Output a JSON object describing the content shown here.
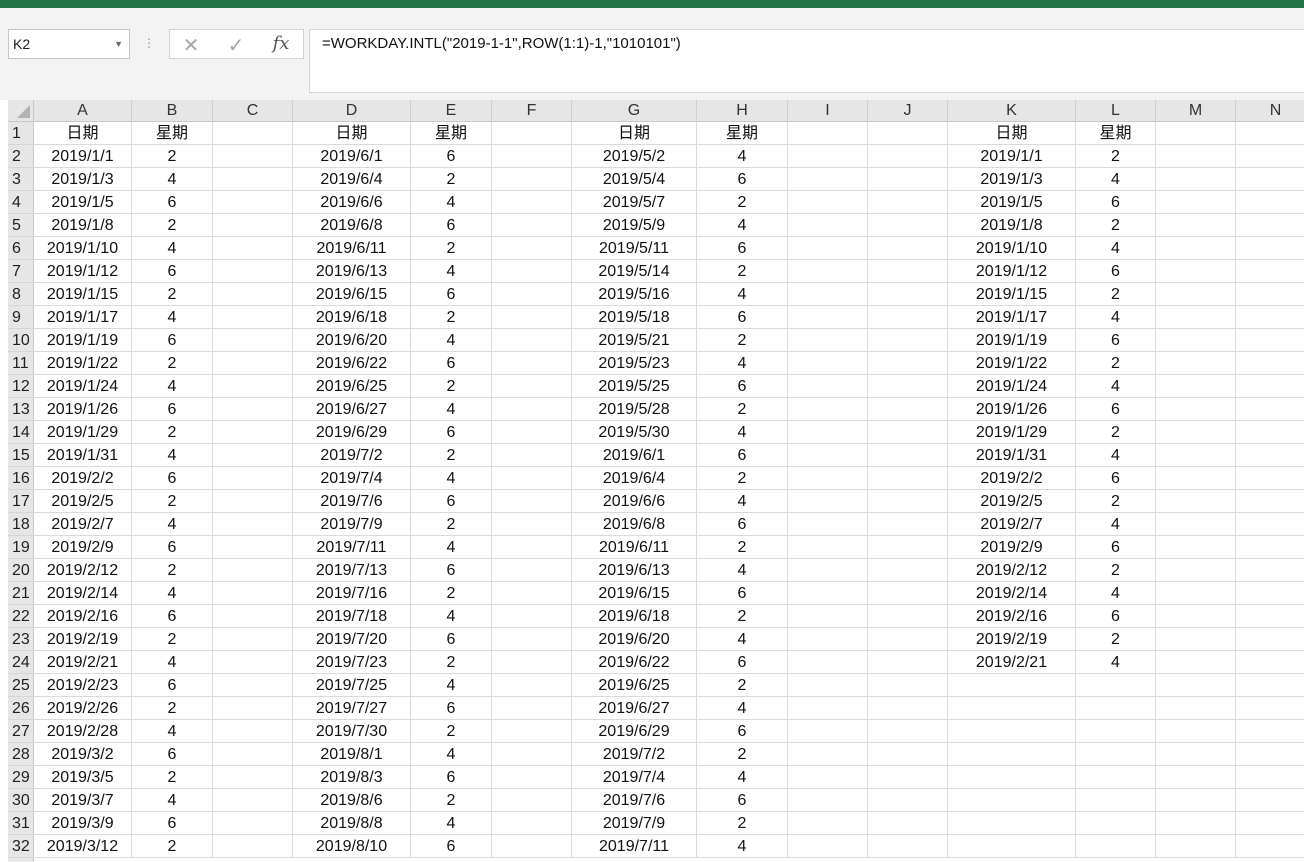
{
  "formula_bar": {
    "name_box": "K2",
    "cancel_glyph": "✕",
    "enter_glyph": "✓",
    "fx_label": "fx",
    "formula": "=WORKDAY.INTL(\"2019-1-1\",ROW(1:1)-1,\"1010101\")"
  },
  "icons": {
    "name_box_dropdown": "chevron-down-icon",
    "cancel": "close-icon",
    "enter": "check-icon",
    "insert_function": "fx-icon",
    "select_all": "select-all-triangle-icon"
  },
  "colors": {
    "ribbon": "#217346",
    "header_bg": "#e6e6e6",
    "gridline": "#dadada"
  },
  "columns": [
    "A",
    "B",
    "C",
    "D",
    "E",
    "F",
    "G",
    "H",
    "I",
    "J",
    "K",
    "L",
    "M",
    "N"
  ],
  "rows": [
    "1",
    "2",
    "3",
    "4",
    "5",
    "6",
    "7",
    "8",
    "9",
    "10",
    "11",
    "12",
    "13",
    "14",
    "15",
    "16",
    "17",
    "18",
    "19",
    "20",
    "21",
    "22",
    "23",
    "24",
    "25",
    "26",
    "27",
    "28",
    "29",
    "30",
    "31",
    "32"
  ],
  "table_ab": {
    "header": [
      "日期",
      "星期"
    ],
    "rows": [
      [
        "2019/1/1",
        "2"
      ],
      [
        "2019/1/3",
        "4"
      ],
      [
        "2019/1/5",
        "6"
      ],
      [
        "2019/1/8",
        "2"
      ],
      [
        "2019/1/10",
        "4"
      ],
      [
        "2019/1/12",
        "6"
      ],
      [
        "2019/1/15",
        "2"
      ],
      [
        "2019/1/17",
        "4"
      ],
      [
        "2019/1/19",
        "6"
      ],
      [
        "2019/1/22",
        "2"
      ],
      [
        "2019/1/24",
        "4"
      ],
      [
        "2019/1/26",
        "6"
      ],
      [
        "2019/1/29",
        "2"
      ],
      [
        "2019/1/31",
        "4"
      ],
      [
        "2019/2/2",
        "6"
      ],
      [
        "2019/2/5",
        "2"
      ],
      [
        "2019/2/7",
        "4"
      ],
      [
        "2019/2/9",
        "6"
      ],
      [
        "2019/2/12",
        "2"
      ],
      [
        "2019/2/14",
        "4"
      ],
      [
        "2019/2/16",
        "6"
      ],
      [
        "2019/2/19",
        "2"
      ],
      [
        "2019/2/21",
        "4"
      ],
      [
        "2019/2/23",
        "6"
      ],
      [
        "2019/2/26",
        "2"
      ],
      [
        "2019/2/28",
        "4"
      ],
      [
        "2019/3/2",
        "6"
      ],
      [
        "2019/3/5",
        "2"
      ],
      [
        "2019/3/7",
        "4"
      ],
      [
        "2019/3/9",
        "6"
      ],
      [
        "2019/3/12",
        "2"
      ]
    ]
  },
  "table_de": {
    "header": [
      "日期",
      "星期"
    ],
    "rows": [
      [
        "2019/6/1",
        "6"
      ],
      [
        "2019/6/4",
        "2"
      ],
      [
        "2019/6/6",
        "4"
      ],
      [
        "2019/6/8",
        "6"
      ],
      [
        "2019/6/11",
        "2"
      ],
      [
        "2019/6/13",
        "4"
      ],
      [
        "2019/6/15",
        "6"
      ],
      [
        "2019/6/18",
        "2"
      ],
      [
        "2019/6/20",
        "4"
      ],
      [
        "2019/6/22",
        "6"
      ],
      [
        "2019/6/25",
        "2"
      ],
      [
        "2019/6/27",
        "4"
      ],
      [
        "2019/6/29",
        "6"
      ],
      [
        "2019/7/2",
        "2"
      ],
      [
        "2019/7/4",
        "4"
      ],
      [
        "2019/7/6",
        "6"
      ],
      [
        "2019/7/9",
        "2"
      ],
      [
        "2019/7/11",
        "4"
      ],
      [
        "2019/7/13",
        "6"
      ],
      [
        "2019/7/16",
        "2"
      ],
      [
        "2019/7/18",
        "4"
      ],
      [
        "2019/7/20",
        "6"
      ],
      [
        "2019/7/23",
        "2"
      ],
      [
        "2019/7/25",
        "4"
      ],
      [
        "2019/7/27",
        "6"
      ],
      [
        "2019/7/30",
        "2"
      ],
      [
        "2019/8/1",
        "4"
      ],
      [
        "2019/8/3",
        "6"
      ],
      [
        "2019/8/6",
        "2"
      ],
      [
        "2019/8/8",
        "4"
      ],
      [
        "2019/8/10",
        "6"
      ]
    ]
  },
  "table_gh": {
    "header": [
      "日期",
      "星期"
    ],
    "rows": [
      [
        "2019/5/2",
        "4"
      ],
      [
        "2019/5/4",
        "6"
      ],
      [
        "2019/5/7",
        "2"
      ],
      [
        "2019/5/9",
        "4"
      ],
      [
        "2019/5/11",
        "6"
      ],
      [
        "2019/5/14",
        "2"
      ],
      [
        "2019/5/16",
        "4"
      ],
      [
        "2019/5/18",
        "6"
      ],
      [
        "2019/5/21",
        "2"
      ],
      [
        "2019/5/23",
        "4"
      ],
      [
        "2019/5/25",
        "6"
      ],
      [
        "2019/5/28",
        "2"
      ],
      [
        "2019/5/30",
        "4"
      ],
      [
        "2019/6/1",
        "6"
      ],
      [
        "2019/6/4",
        "2"
      ],
      [
        "2019/6/6",
        "4"
      ],
      [
        "2019/6/8",
        "6"
      ],
      [
        "2019/6/11",
        "2"
      ],
      [
        "2019/6/13",
        "4"
      ],
      [
        "2019/6/15",
        "6"
      ],
      [
        "2019/6/18",
        "2"
      ],
      [
        "2019/6/20",
        "4"
      ],
      [
        "2019/6/22",
        "6"
      ],
      [
        "2019/6/25",
        "2"
      ],
      [
        "2019/6/27",
        "4"
      ],
      [
        "2019/6/29",
        "6"
      ],
      [
        "2019/7/2",
        "2"
      ],
      [
        "2019/7/4",
        "4"
      ],
      [
        "2019/7/6",
        "6"
      ],
      [
        "2019/7/9",
        "2"
      ],
      [
        "2019/7/11",
        "4"
      ]
    ]
  },
  "table_kl": {
    "header": [
      "日期",
      "星期"
    ],
    "rows": [
      [
        "2019/1/1",
        "2"
      ],
      [
        "2019/1/3",
        "4"
      ],
      [
        "2019/1/5",
        "6"
      ],
      [
        "2019/1/8",
        "2"
      ],
      [
        "2019/1/10",
        "4"
      ],
      [
        "2019/1/12",
        "6"
      ],
      [
        "2019/1/15",
        "2"
      ],
      [
        "2019/1/17",
        "4"
      ],
      [
        "2019/1/19",
        "6"
      ],
      [
        "2019/1/22",
        "2"
      ],
      [
        "2019/1/24",
        "4"
      ],
      [
        "2019/1/26",
        "6"
      ],
      [
        "2019/1/29",
        "2"
      ],
      [
        "2019/1/31",
        "4"
      ],
      [
        "2019/2/2",
        "6"
      ],
      [
        "2019/2/5",
        "2"
      ],
      [
        "2019/2/7",
        "4"
      ],
      [
        "2019/2/9",
        "6"
      ],
      [
        "2019/2/12",
        "2"
      ],
      [
        "2019/2/14",
        "4"
      ],
      [
        "2019/2/16",
        "6"
      ],
      [
        "2019/2/19",
        "2"
      ],
      [
        "2019/2/21",
        "4"
      ]
    ]
  }
}
